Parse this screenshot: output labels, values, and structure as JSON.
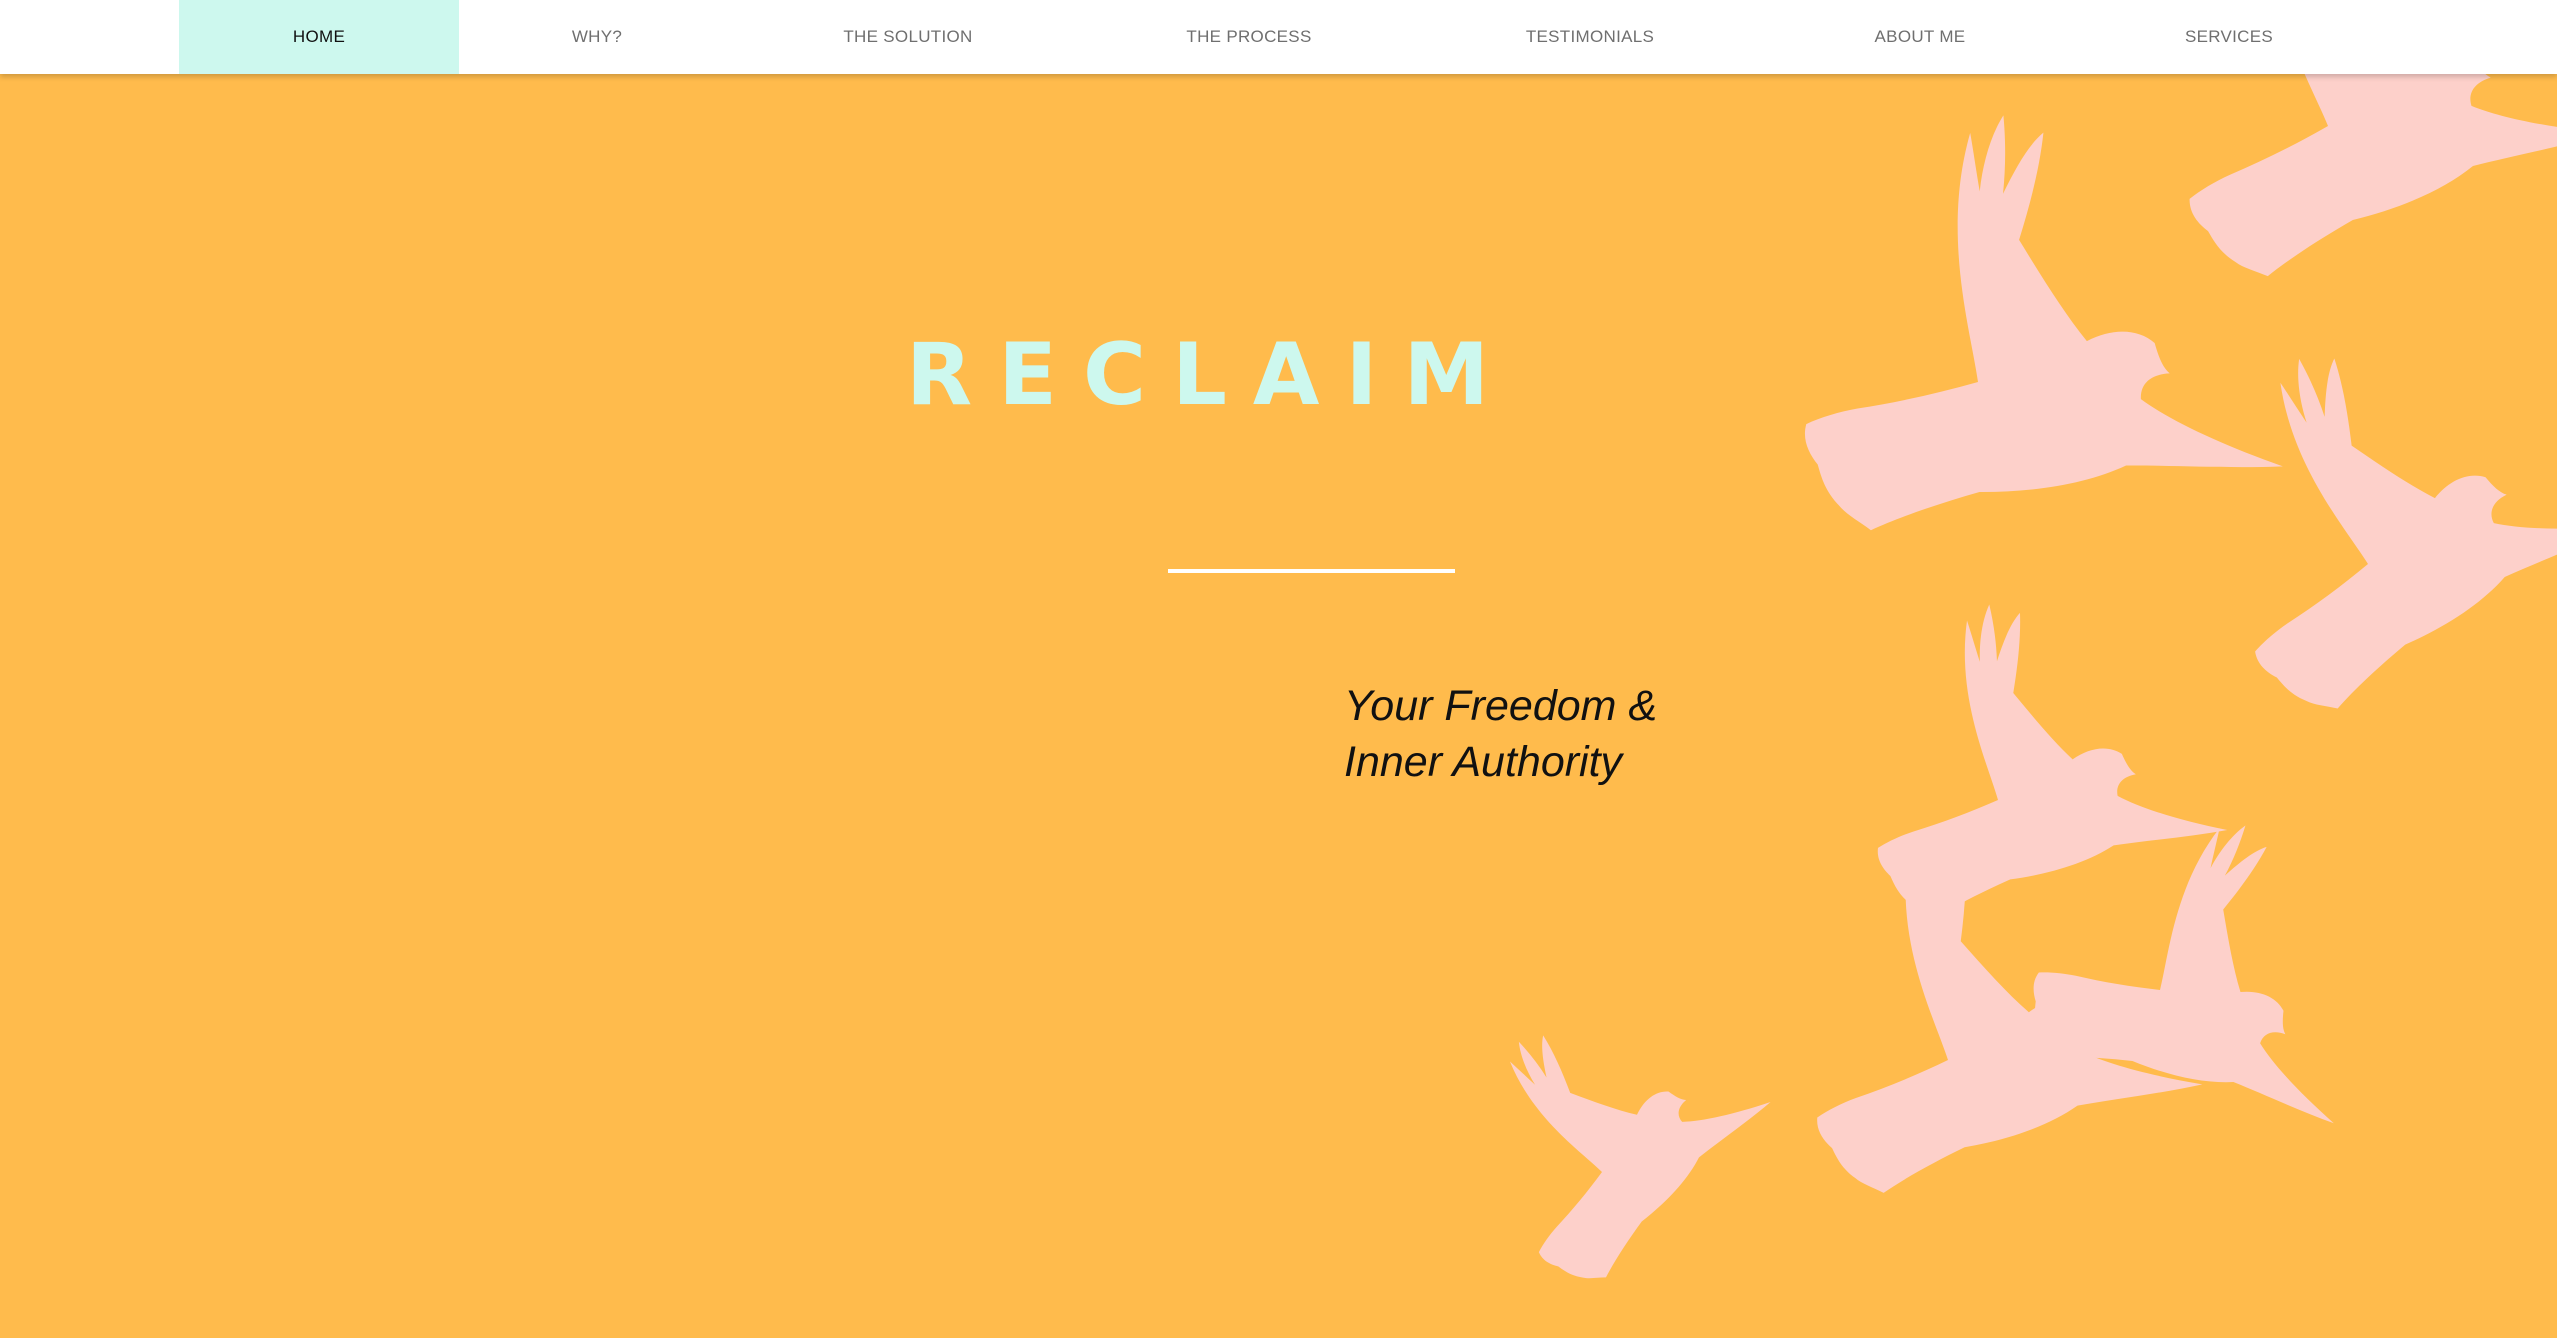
{
  "nav": {
    "items": [
      {
        "label": "HOME",
        "active": true
      },
      {
        "label": "WHY?"
      },
      {
        "label": "THE SOLUTION"
      },
      {
        "label": "THE PROCESS"
      },
      {
        "label": "TESTIMONIALS"
      },
      {
        "label": "ABOUT ME"
      },
      {
        "label": "SERVICES"
      }
    ]
  },
  "hero": {
    "title": "RECLAIM",
    "tagline_line1": "Your Freedom &",
    "tagline_line2": "Inner Authority",
    "illustration": "flying-doves"
  },
  "colors": {
    "background": "#ffbb4c",
    "title": "#cdf8ee",
    "nav_active": "#cdf8ee",
    "doves": "#fdd0ca",
    "rule": "#ffffff"
  }
}
